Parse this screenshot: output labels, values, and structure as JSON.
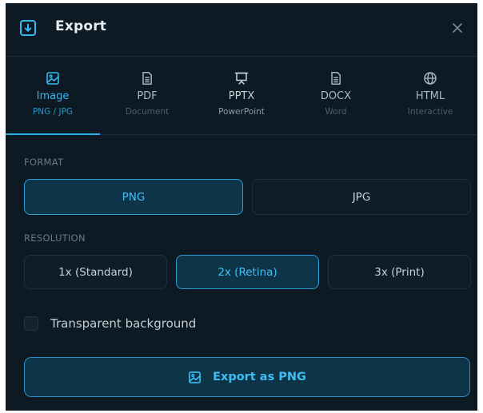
{
  "header": {
    "title": "Export",
    "icon": "download-icon",
    "close_icon": "close-icon"
  },
  "tabs": [
    {
      "label": "Image",
      "sub": "PNG / JPG",
      "icon": "image-icon",
      "active": true
    },
    {
      "label": "PDF",
      "sub": "Document",
      "icon": "document-icon",
      "active": false
    },
    {
      "label": "PPTX",
      "sub": "PowerPoint",
      "icon": "presentation-icon",
      "active": false
    },
    {
      "label": "DOCX",
      "sub": "Word",
      "icon": "document-icon",
      "active": false
    },
    {
      "label": "HTML",
      "sub": "Interactive",
      "icon": "globe-icon",
      "active": false
    }
  ],
  "format": {
    "label": "FORMAT",
    "options": [
      "PNG",
      "JPG"
    ],
    "selected": "PNG"
  },
  "resolution": {
    "label": "RESOLUTION",
    "options": [
      "1x (Standard)",
      "2x (Retina)",
      "3x (Print)"
    ],
    "selected": "2x (Retina)"
  },
  "transparent": {
    "label": "Transparent background",
    "checked": false
  },
  "export_button": {
    "label": "Export as PNG",
    "icon": "image-icon"
  },
  "colors": {
    "background": "#0d1923",
    "accent": "#2bb3ee",
    "selected_bg": "#0e3448"
  }
}
